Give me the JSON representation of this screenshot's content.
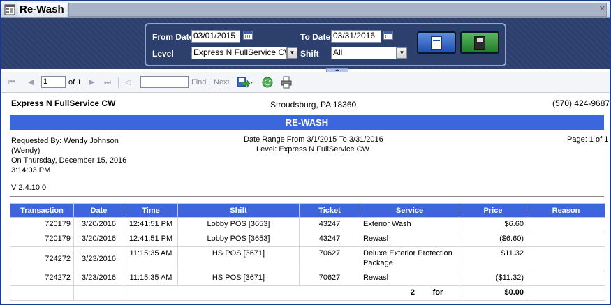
{
  "window": {
    "title": "Re-Wash"
  },
  "params": {
    "from_date_label": "From Date",
    "from_date": "03/01/2015",
    "to_date_label": "To Date",
    "to_date": "03/31/2016",
    "level_label": "Level",
    "level_value": "Express N FullService CW",
    "shift_label": "Shift",
    "shift_value": "All"
  },
  "toolbar": {
    "page_value": "1",
    "of_pages": "of 1",
    "find_label": "Find",
    "divider": "|",
    "next_label": "Next"
  },
  "report": {
    "company": "Express N FullService CW",
    "city": "Stroudsburg, PA 18360",
    "phone": "(570) 424-9687",
    "title": "RE-WASH",
    "requested_by": "Requested By: Wendy Johnson",
    "requester_alias": "(Wendy)",
    "on_date": "On Thursday, December 15, 2016",
    "on_time": "3:14:03 PM",
    "version": "V 2.4.10.0",
    "date_range": "Date Range From 3/1/2015 To 3/31/2016",
    "level": "Level: Express N FullService CW",
    "page": "Page: 1 of 1"
  },
  "table": {
    "headers": [
      "Transaction",
      "Date",
      "Time",
      "Shift",
      "Ticket",
      "Service",
      "Price",
      "Reason"
    ],
    "rows": [
      [
        "720179",
        "3/20/2016",
        "12:41:51 PM",
        "Lobby POS [3653]",
        "43247",
        "Exterior Wash",
        "$6.60",
        ""
      ],
      [
        "720179",
        "3/20/2016",
        "12:41:51 PM",
        "Lobby POS [3653]",
        "43247",
        "Rewash",
        "($6.60)",
        ""
      ],
      [
        "724272",
        "3/23/2016",
        "11:15:35 AM",
        "HS POS [3671]",
        "70627",
        "Deluxe Exterior Protection Package",
        "$11.32",
        ""
      ],
      [
        "724272",
        "3/23/2016",
        "11:15:35 AM",
        "HS POS [3671]",
        "70627",
        "Rewash",
        "($11.32)",
        ""
      ]
    ],
    "total_count": "2",
    "total_for": "for",
    "total_price": "$0.00"
  },
  "colors": {
    "accent": "#3b66dc",
    "header_band": "#2c3f6d",
    "window_border": "#1f3c88"
  },
  "icons": [
    "report-window-icon",
    "close-icon",
    "calendar-icon",
    "dropdown-arrow-icon",
    "view-report-icon",
    "save-icon",
    "first-page-icon",
    "previous-page-icon",
    "next-page-icon",
    "last-page-icon",
    "back-icon",
    "export-icon",
    "refresh-icon",
    "print-icon",
    "collapse-icon"
  ]
}
